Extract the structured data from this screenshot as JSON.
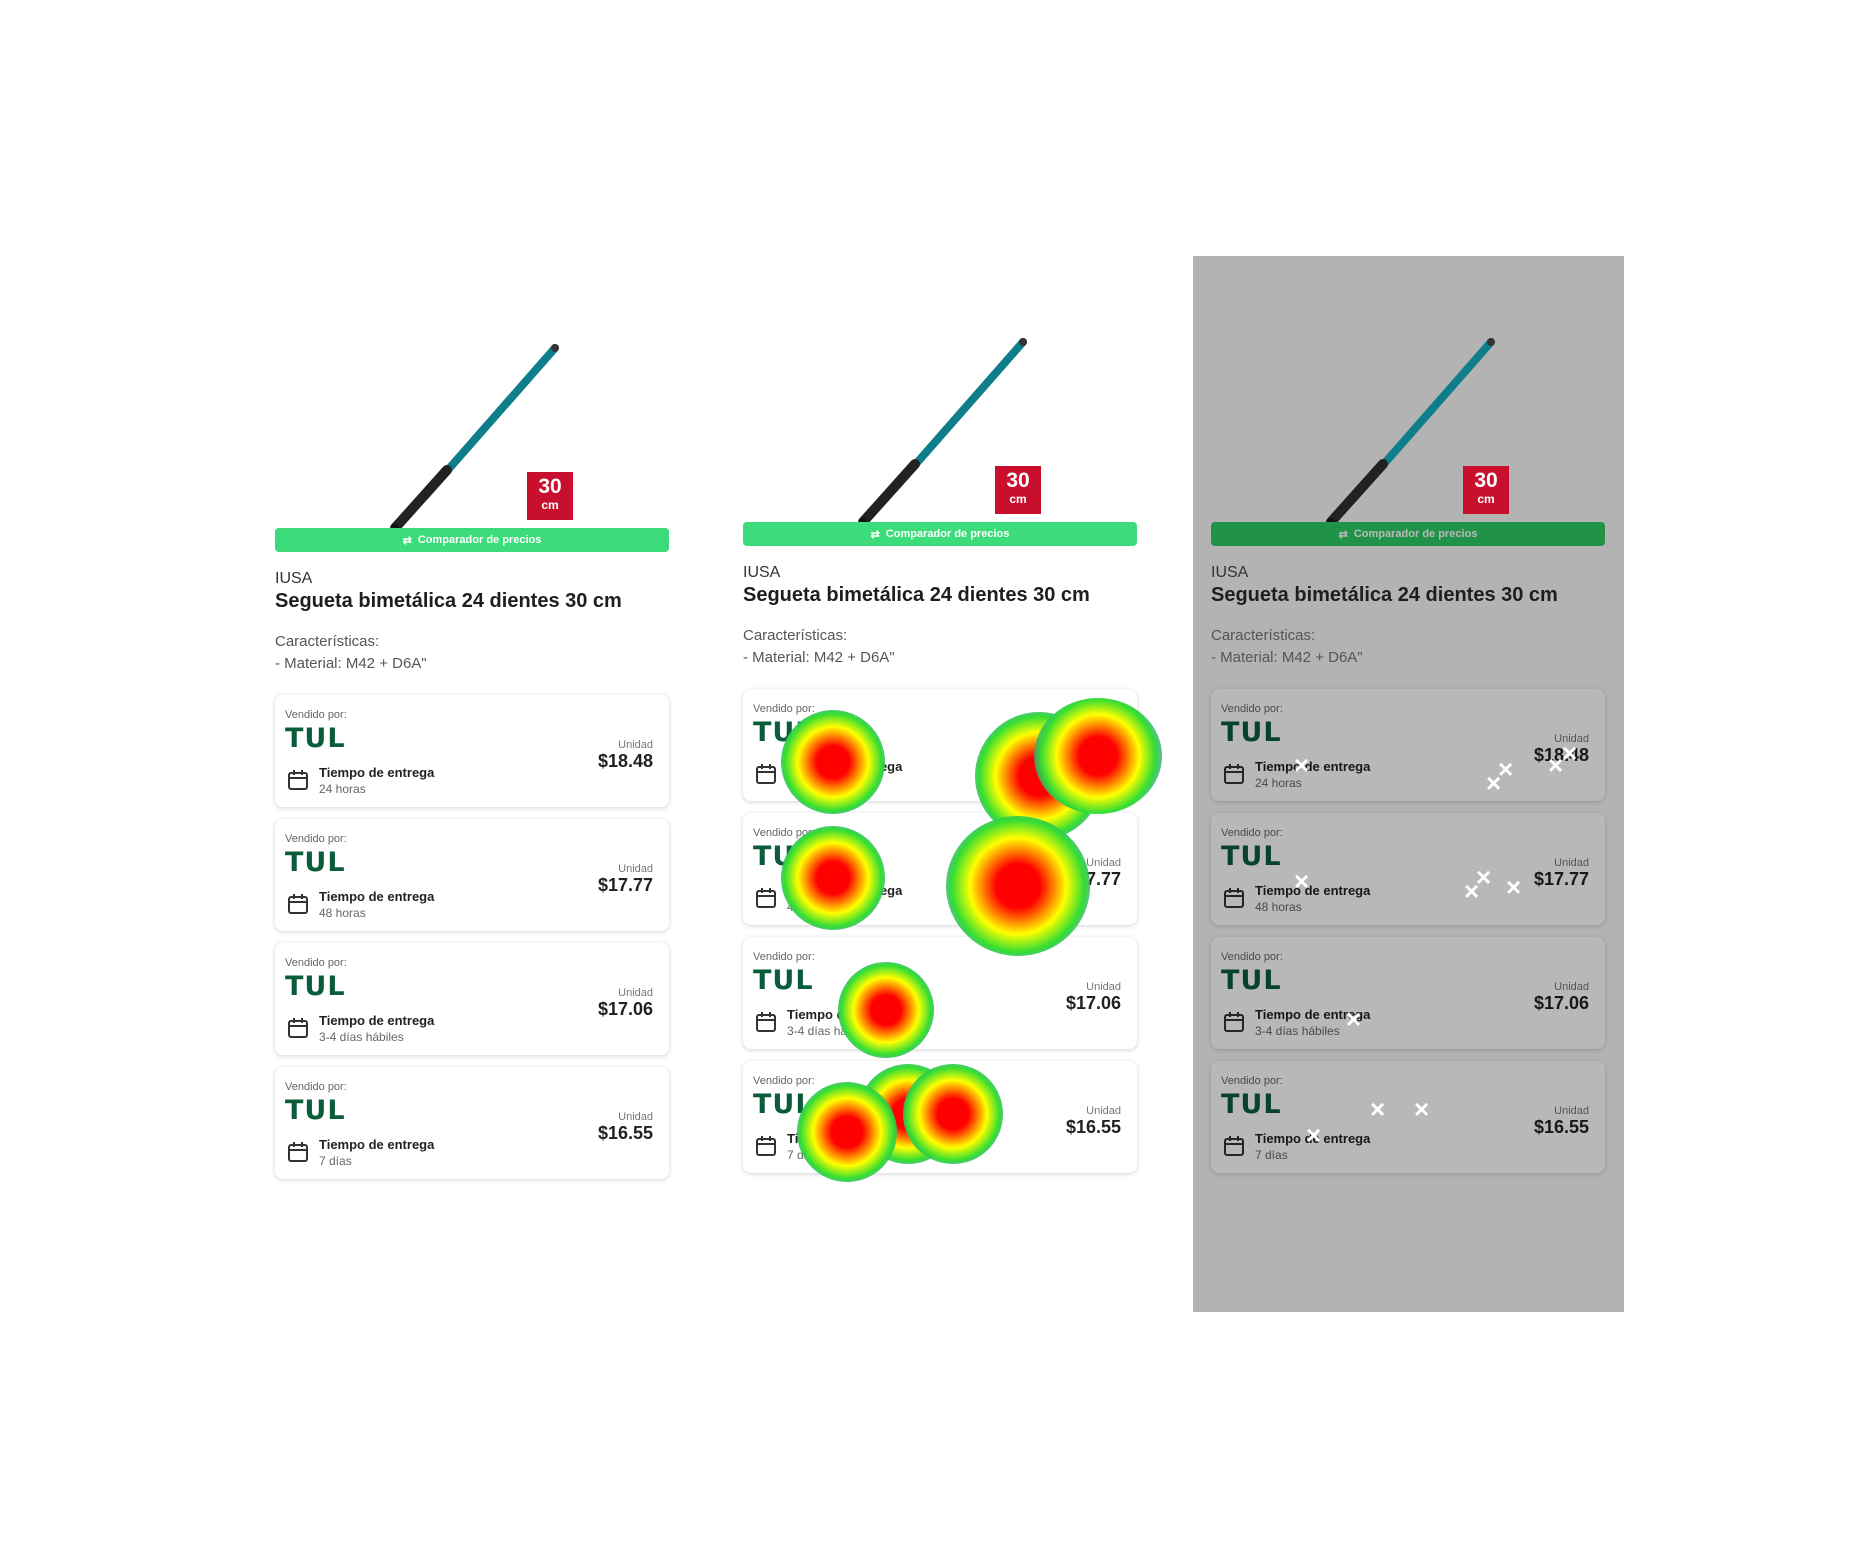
{
  "product": {
    "brand": "IUSA",
    "title": "Segueta bimetálica 24 dientes 30 cm",
    "features_heading": "Características:",
    "features_line": "- Material: M42 + D6A\"",
    "badge_number": "30",
    "badge_unit": "cm",
    "compare_label": "Comparador de precios"
  },
  "offers": [
    {
      "sold_by_label": "Vendido por:",
      "seller": "TUL",
      "delivery_label": "Tiempo de entrega",
      "delivery_time": "24 horas",
      "unit_label": "Unidad",
      "price": "$18.48"
    },
    {
      "sold_by_label": "Vendido por:",
      "seller": "TUL",
      "delivery_label": "Tiempo de entrega",
      "delivery_time": "48 horas",
      "unit_label": "Unidad",
      "price": "$17.77"
    },
    {
      "sold_by_label": "Vendido por:",
      "seller": "TUL",
      "delivery_label": "Tiempo de entrega",
      "delivery_time": "3-4 días hábiles",
      "unit_label": "Unidad",
      "price": "$17.06"
    },
    {
      "sold_by_label": "Vendido por:",
      "seller": "TUL",
      "delivery_label": "Tiempo de entrega",
      "delivery_time": "7 días",
      "unit_label": "Unidad",
      "price": "$16.55"
    }
  ],
  "colors": {
    "badge": "#c8102e",
    "compare_bar": "#3ddc7a",
    "seller_logo": "#0b5c3a",
    "saw_blade": "#0e7f8a",
    "overlay_gray": "#b3b3b3"
  },
  "icons": [
    "saw-blade-image",
    "compare-arrows-icon",
    "calendar-icon",
    "click-x-mark-icon"
  ]
}
